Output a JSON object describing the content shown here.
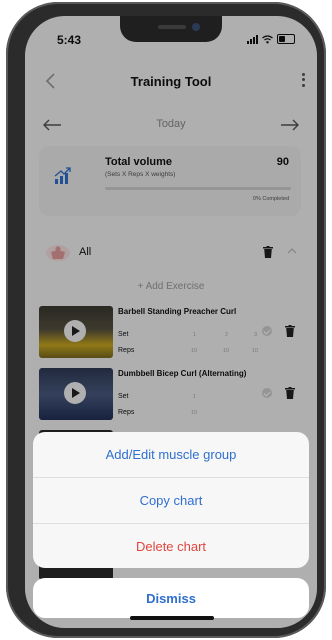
{
  "status": {
    "time": "5:43"
  },
  "header": {
    "title": "Training Tool",
    "back_icon": "chevron-left-icon",
    "menu_icon": "kebab-menu-icon"
  },
  "date_nav": {
    "label": "Today"
  },
  "volume": {
    "title": "Total volume",
    "subtitle": "(Sets X Reps X weights)",
    "value": "90",
    "progress": 0,
    "completed": "0% Completed"
  },
  "group": {
    "name": "All"
  },
  "add_exercise": "+ Add Exercise",
  "exercises": [
    {
      "name": "Barbell Standing Preacher Curl",
      "sets_label": "Set",
      "reps_label": "Reps",
      "sets": [
        "1",
        "2",
        "3"
      ],
      "reps": [
        "10",
        "10",
        "10"
      ]
    },
    {
      "name": "Dumbbell Bicep Curl (Alternating)",
      "sets_label": "Set",
      "reps_label": "Reps",
      "sets": [
        "1"
      ],
      "reps": [
        "10"
      ]
    }
  ],
  "sheet": {
    "actions": [
      "Add/Edit muscle group",
      "Copy chart",
      "Delete chart"
    ],
    "dismiss": "Dismiss"
  },
  "colors": {
    "accent": "#2f6fd0",
    "danger": "#e0463f",
    "progress": "#4a8fd8"
  }
}
